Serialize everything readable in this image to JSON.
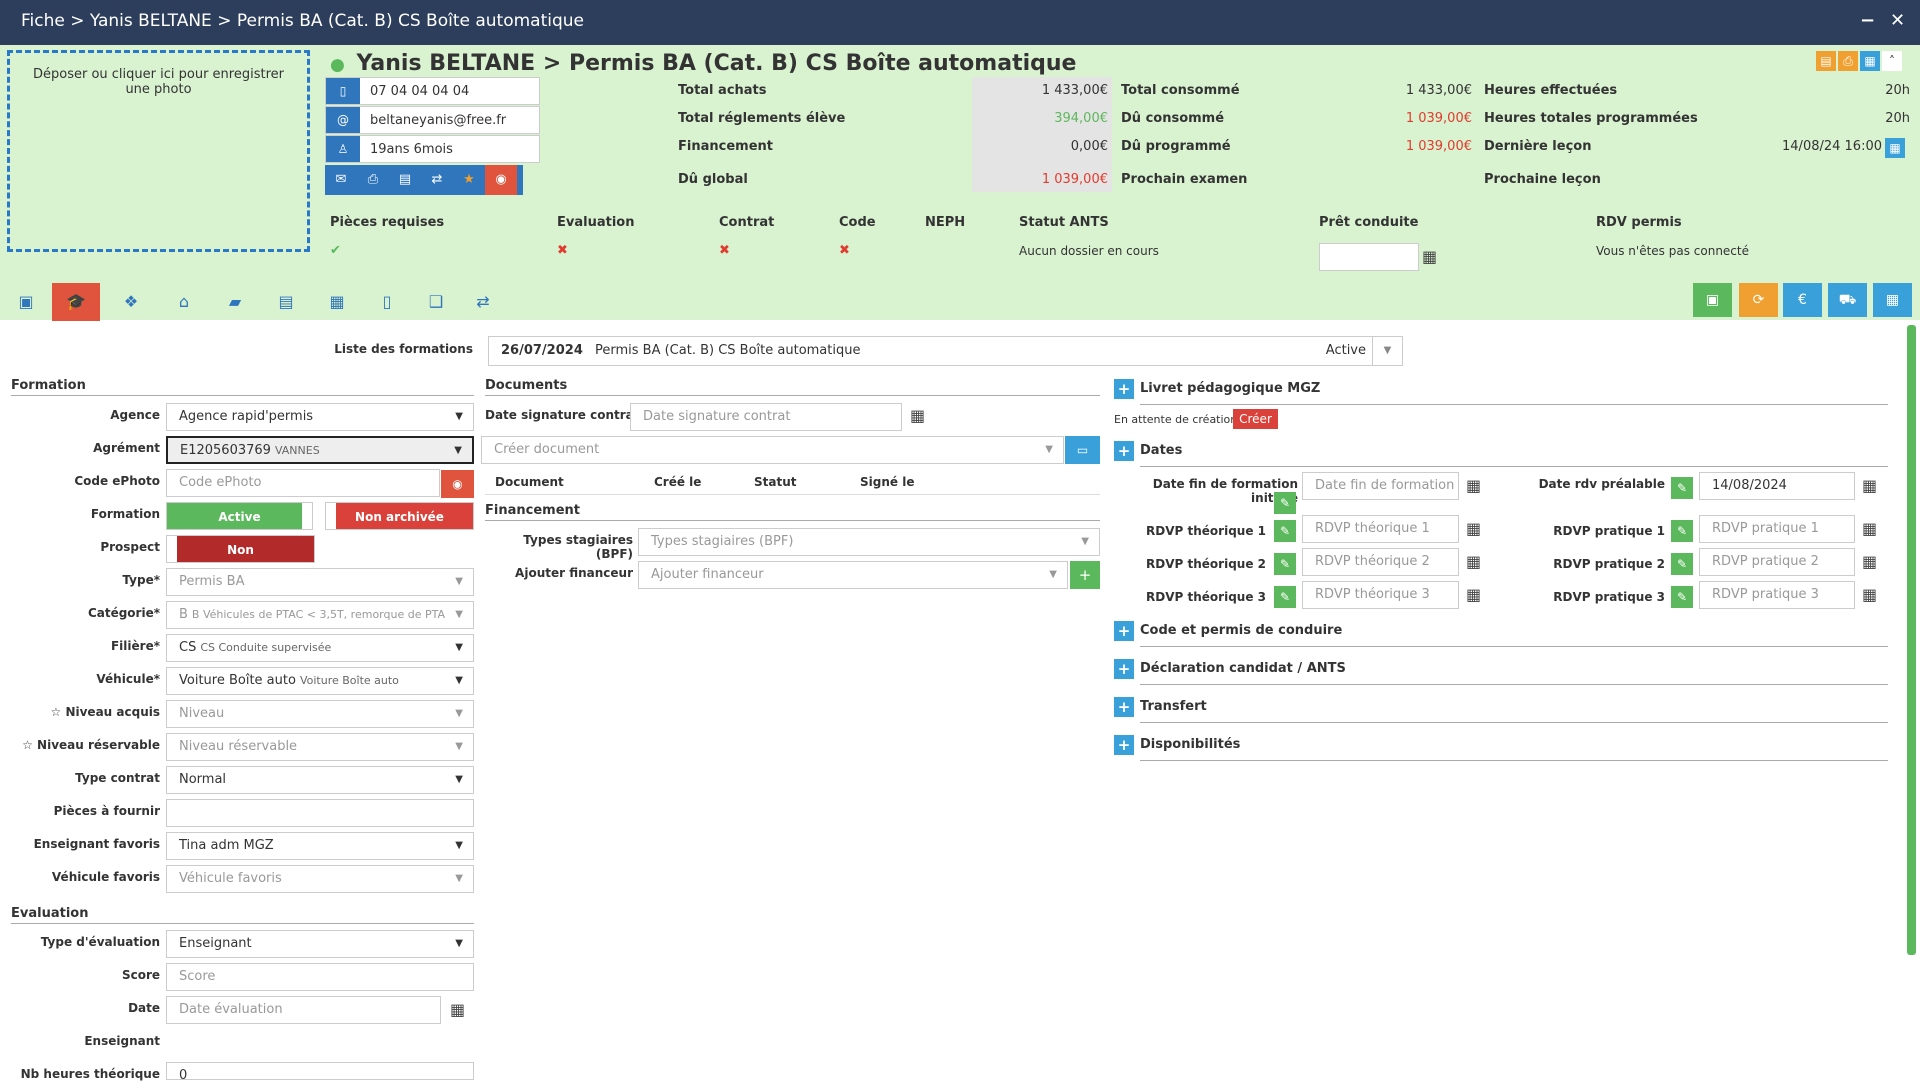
{
  "window": {
    "breadcrumb": "Fiche > Yanis BELTANE > Permis BA (Cat. B) CS Boîte automatique",
    "minimize": "−",
    "close": "✕"
  },
  "header": {
    "photo_hint": "Déposer ou cliquer ici pour enregistrer une photo",
    "student_name": "Yanis BELTANE",
    "formation_title": "Permis BA (Cat. B) CS Boîte automatique",
    "phone": "07 04 04 04 04",
    "email": "beltaneyanis@free.fr",
    "age": "19ans 6mois"
  },
  "summary": {
    "total_achats_label": "Total achats",
    "total_achats": "1 433,00€",
    "total_reglements_label": "Total réglements élève",
    "total_reglements": "394,00€",
    "financement_label": "Financement",
    "financement": "0,00€",
    "du_global_label": "Dû global",
    "du_global": "1 039,00€",
    "total_consomme_label": "Total consommé",
    "total_consomme": "1 433,00€",
    "du_consomme_label": "Dû consommé",
    "du_consomme": "1 039,00€",
    "du_programme_label": "Dû programmé",
    "du_programme": "1 039,00€",
    "prochain_examen_label": "Prochain examen",
    "heures_effectuees_label": "Heures effectuées",
    "heures_effectuees": "20h",
    "heures_programmees_label": "Heures totales programmées",
    "heures_programmees": "20h",
    "derniere_lecon_label": "Dernière leçon",
    "derniere_lecon": "14/08/24 16:00",
    "prochaine_lecon_label": "Prochaine leçon"
  },
  "status": {
    "pieces_label": "Pièces requises",
    "evaluation_label": "Evaluation",
    "contrat_label": "Contrat",
    "code_label": "Code",
    "neph_label": "NEPH",
    "ants_label": "Statut ANTS",
    "ants_value": "Aucun dossier en cours",
    "pret_label": "Prêt conduite",
    "rdv_label": "RDV permis",
    "rdv_value": "Vous n'êtes pas connecté"
  },
  "liste_formations": {
    "label": "Liste des formations",
    "date": "26/07/2024",
    "name": "Permis BA (Cat. B) CS Boîte automatique",
    "state": "Active"
  },
  "formation": {
    "section": "Formation",
    "agence_label": "Agence",
    "agence": "Agence rapid'permis",
    "agrement_label": "Agrément",
    "agrement": "E1205603769",
    "agrement_sub": "VANNES",
    "ephoto_label": "Code ePhoto",
    "ephoto_ph": "Code ePhoto",
    "formation_label": "Formation",
    "active": "Active",
    "non_archivee": "Non archivée",
    "prospect_label": "Prospect",
    "prospect": "Non",
    "type_label": "Type*",
    "type": "Permis BA",
    "categorie_label": "Catégorie*",
    "categorie": "B",
    "categorie_sub": "B Véhicules de PTAC < 3,5T, remorque de PTA",
    "filiere_label": "Filière*",
    "filiere": "CS",
    "filiere_sub": "CS Conduite supervisée",
    "vehicule_label": "Véhicule*",
    "vehicule": "Voiture Boîte auto",
    "vehicule_sub": "Voiture Boîte auto",
    "niveau_acquis_label": "☆ Niveau acquis",
    "niveau_acquis_ph": "Niveau",
    "niveau_res_label": "☆ Niveau réservable",
    "niveau_res_ph": "Niveau réservable",
    "type_contrat_label": "Type contrat",
    "type_contrat": "Normal",
    "pieces_label": "Pièces à fournir",
    "enseignant_label": "Enseignant favoris",
    "enseignant": "Tina adm MGZ",
    "vehicule_fav_label": "Véhicule favoris",
    "vehicule_fav_ph": "Véhicule favoris"
  },
  "evaluation": {
    "section": "Evaluation",
    "type_label": "Type d'évaluation",
    "type": "Enseignant",
    "score_label": "Score",
    "score_ph": "Score",
    "date_label": "Date",
    "date_ph": "Date évaluation",
    "enseignant_label": "Enseignant",
    "nb_label": "Nb heures théorique",
    "nb": "0"
  },
  "documents": {
    "section": "Documents",
    "date_sig_label": "Date signature contrat",
    "date_sig_ph": "Date signature contrat",
    "creer_ph": "Créer document",
    "cols": [
      "Document",
      "Créé le",
      "Statut",
      "Signé le"
    ],
    "fin_section": "Financement",
    "types_label": "Types stagiaires (BPF)",
    "types_ph": "Types stagiaires (BPF)",
    "financeur_label": "Ajouter financeur",
    "financeur_ph": "Ajouter financeur"
  },
  "right": {
    "livret": "Livret pédagogique MGZ",
    "attente": "En attente de création",
    "creer": "Créer",
    "dates": "Dates",
    "date_fin_label": "Date fin de formation initiale",
    "date_fin_ph": "Date fin de formation",
    "rdv_prealable_label": "Date rdv préalable",
    "rdv_prealable": "14/08/2024",
    "rdvp_t1_label": "RDVP théorique 1",
    "rdvp_t1_ph": "RDVP théorique 1",
    "rdvp_t2_label": "RDVP théorique 2",
    "rdvp_t2_ph": "RDVP théorique 2",
    "rdvp_t3_label": "RDVP théorique 3",
    "rdvp_t3_ph": "RDVP théorique 3",
    "rdvp_p1_label": "RDVP pratique 1",
    "rdvp_p1_ph": "RDVP pratique 1",
    "rdvp_p2_label": "RDVP pratique 2",
    "rdvp_p2_ph": "RDVP pratique 2",
    "rdvp_p3_label": "RDVP pratique 3",
    "rdvp_p3_ph": "RDVP pratique 3",
    "code_permis": "Code et permis de conduire",
    "declaration": "Déclaration candidat / ANTS",
    "transfert": "Transfert",
    "dispo": "Disponibilités"
  }
}
